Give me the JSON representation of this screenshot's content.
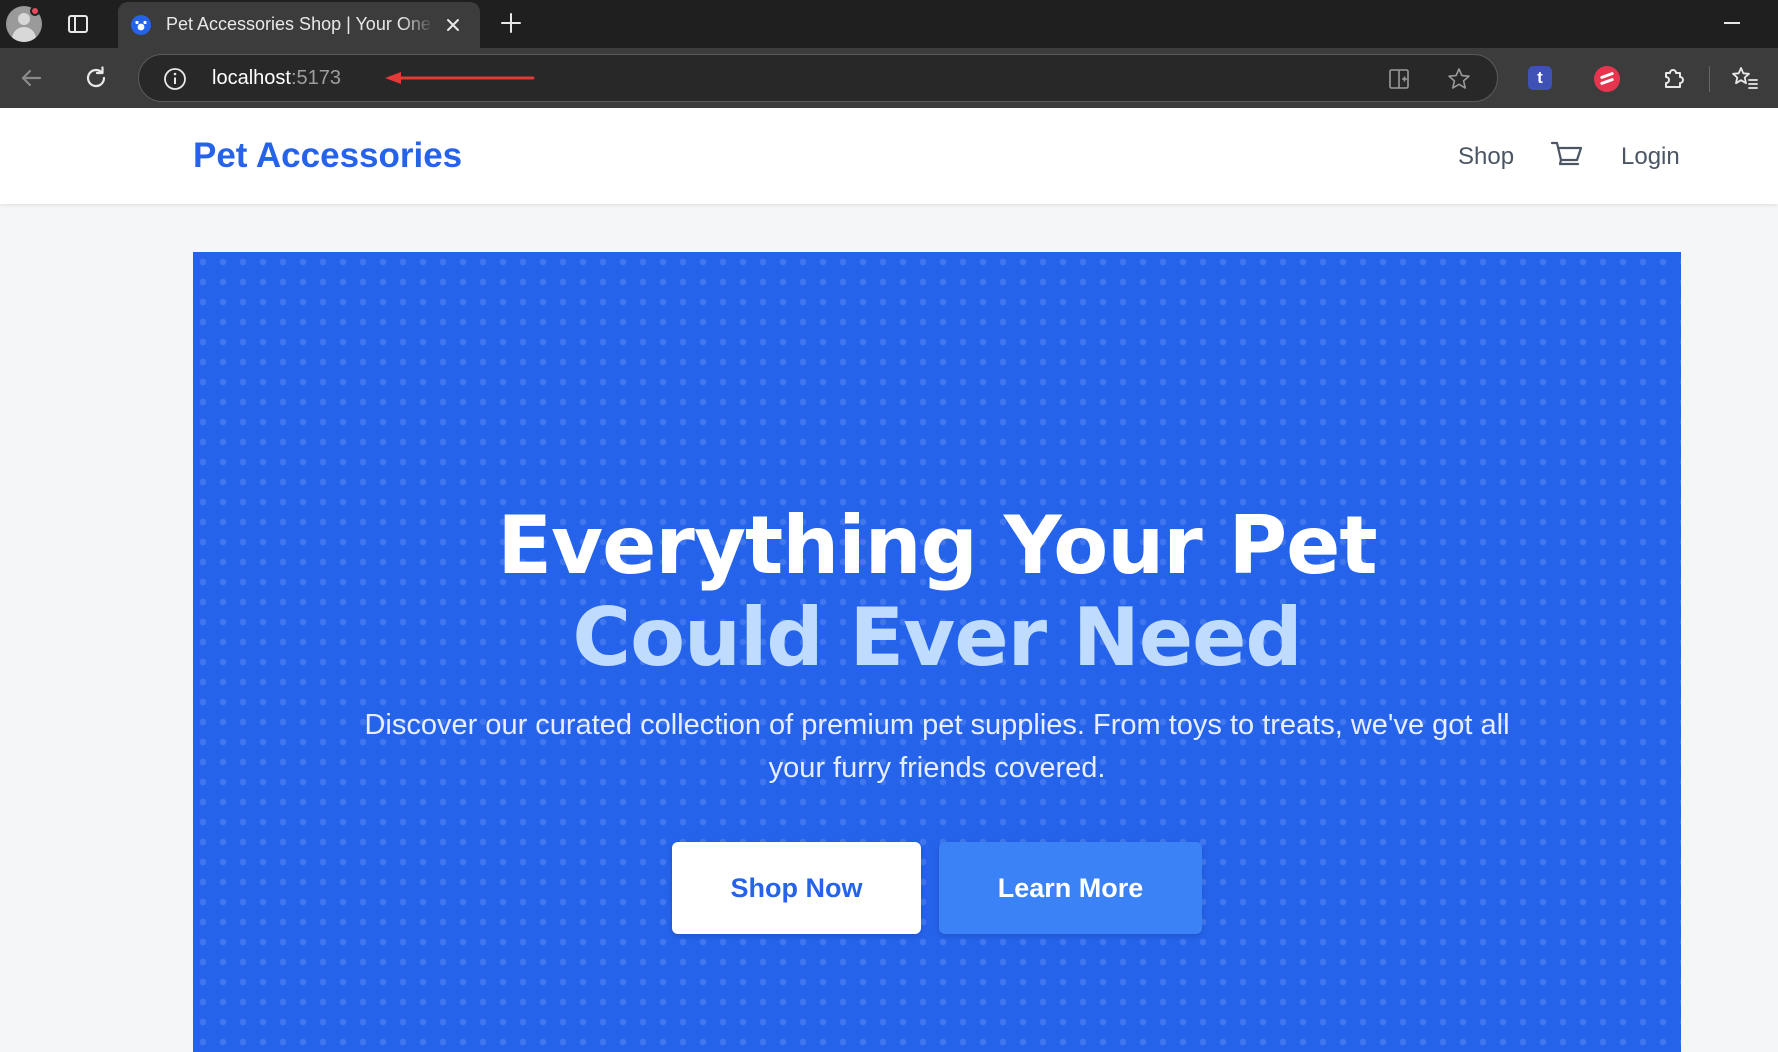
{
  "browser": {
    "tab": {
      "title": "Pet Accessories Shop | Your One-Stop Pet Store",
      "favicon": "paw-icon"
    },
    "address": {
      "host": "localhost",
      "port": ":5173"
    },
    "colors": {
      "chrome_dark": "#1f1f1f",
      "toolbar": "#3c3c3c",
      "annotation_arrow": "#e53935"
    }
  },
  "site": {
    "brand": "Pet Accessories",
    "nav": {
      "shop": "Shop",
      "login": "Login"
    },
    "colors": {
      "primary": "#2563eb",
      "hero_accent": "#bfdbfe",
      "secondary_button": "#3b82f6"
    }
  },
  "hero": {
    "title_line1": "Everything Your Pet",
    "title_line2": "Could Ever Need",
    "subtitle": "Discover our curated collection of premium pet supplies. From toys to treats, we've got all your furry friends covered.",
    "primary_cta": "Shop Now",
    "secondary_cta": "Learn More"
  }
}
